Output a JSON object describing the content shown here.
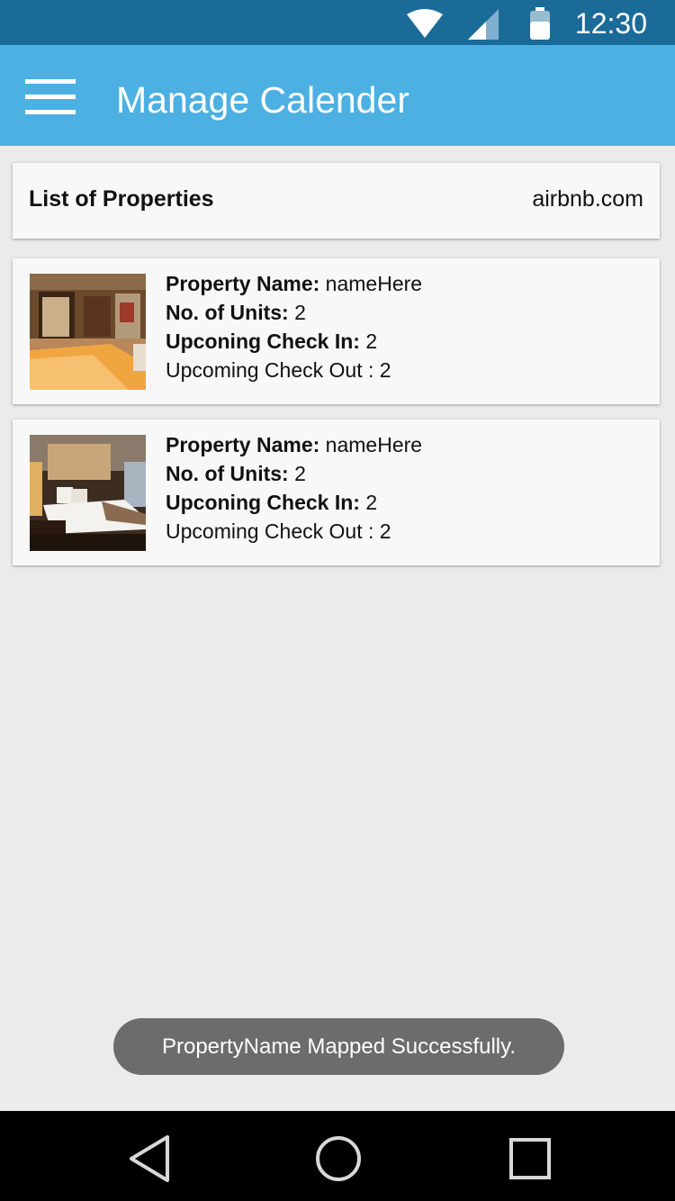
{
  "status_bar": {
    "time": "12:30",
    "icons": [
      "wifi-icon",
      "signal-icon",
      "battery-icon"
    ]
  },
  "app_bar": {
    "title": "Manage Calender",
    "menu_icon": "hamburger-menu-icon"
  },
  "list_header": {
    "title": "List of Properties",
    "source": "airbnb.com"
  },
  "labels": {
    "property_name": "Property Name:",
    "units": "No. of Units:",
    "check_in": "Upconing Check In:",
    "check_out": "Upcoming Check Out"
  },
  "properties": [
    {
      "name": "nameHere",
      "units": "2",
      "check_in": "2",
      "check_out": ": 2",
      "image": "bedroom-photo"
    },
    {
      "name": "nameHere",
      "units": "2",
      "check_in": "2",
      "check_out": ": 2",
      "image": "hotel-room-photo"
    }
  ],
  "toast": {
    "message": "PropertyName Mapped Successfully."
  },
  "nav_bar": {
    "icons": [
      "back-icon",
      "home-icon",
      "recents-icon"
    ]
  },
  "colors": {
    "status_bar": "#1b6b98",
    "app_bar": "#4cb0e3",
    "background": "#ebebeb",
    "toast": "#6c6c6c"
  }
}
